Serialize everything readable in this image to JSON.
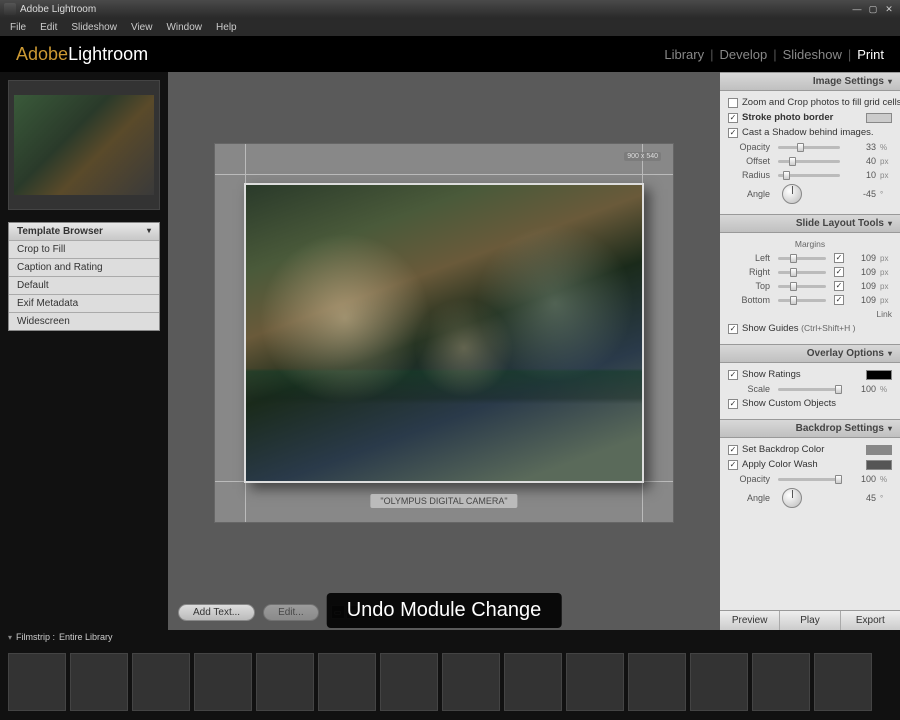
{
  "titlebar": {
    "title": "Adobe Lightroom"
  },
  "menu": {
    "file": "File",
    "edit": "Edit",
    "slideshow": "Slideshow",
    "view": "View",
    "window": "Window",
    "help": "Help"
  },
  "header": {
    "logo_a": "Adobe",
    "logo_b": "Lightroom",
    "nav": {
      "library": "Library",
      "develop": "Develop",
      "slideshow": "Slideshow",
      "print": "Print"
    }
  },
  "left": {
    "template_header": "Template Browser",
    "templates": [
      "Crop to Fill",
      "Caption and Rating",
      "Default",
      "Exif Metadata",
      "Widescreen"
    ]
  },
  "center": {
    "caption": "\"OLYMPUS DIGITAL CAMERA\"",
    "dim": "900 x 540",
    "add_text": "Add Text...",
    "edit": "Edit...",
    "toast": "Undo Module Change"
  },
  "right": {
    "image_settings": {
      "header": "Image Settings",
      "zoom_crop": "Zoom and Crop photos to fill grid cells.",
      "stroke": "Stroke photo border",
      "shadow": "Cast a Shadow behind images.",
      "opacity_l": "Opacity",
      "opacity_v": "33",
      "opacity_u": "%",
      "offset_l": "Offset",
      "offset_v": "40",
      "offset_u": "px",
      "radius_l": "Radius",
      "radius_v": "10",
      "radius_u": "px",
      "angle_l": "Angle",
      "angle_v": "-45",
      "angle_u": "°"
    },
    "layout": {
      "header": "Slide Layout Tools",
      "margins": "Margins",
      "left_l": "Left",
      "left_v": "109",
      "right_l": "Right",
      "right_v": "109",
      "top_l": "Top",
      "top_v": "109",
      "bottom_l": "Bottom",
      "bottom_v": "109",
      "px": "px",
      "link": "Link",
      "guides": "Show Guides",
      "guides_hint": "(Ctrl+Shift+H )"
    },
    "overlay": {
      "header": "Overlay Options",
      "ratings": "Show Ratings",
      "scale_l": "Scale",
      "scale_v": "100",
      "scale_u": "%",
      "custom": "Show Custom Objects"
    },
    "backdrop": {
      "header": "Backdrop Settings",
      "color": "Set Backdrop Color",
      "wash": "Apply Color Wash",
      "opacity_l": "Opacity",
      "opacity_v": "100",
      "opacity_u": "%",
      "angle_l": "Angle",
      "angle_v": "45",
      "angle_u": "°"
    },
    "actions": {
      "preview": "Preview",
      "play": "Play",
      "export": "Export"
    }
  },
  "filmstrip": {
    "label": "Filmstrip :",
    "scope": "Entire Library"
  }
}
